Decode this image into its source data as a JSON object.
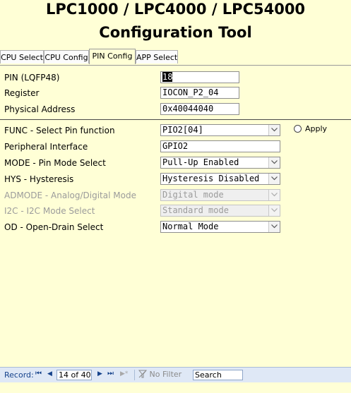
{
  "header": {
    "line1": "LPC1000 / LPC4000 / LPC54000",
    "line2": "Configuration Tool"
  },
  "tabs": [
    {
      "label": "CPU Select",
      "active": false
    },
    {
      "label": "CPU Config",
      "active": false
    },
    {
      "label": "PIN Config",
      "active": true
    },
    {
      "label": "APP Select",
      "active": false
    }
  ],
  "pin_section": {
    "pin_label": "PIN (LQFP48)",
    "pin_value": "18",
    "register_label": "Register",
    "register_value": "IOCON_P2_04",
    "address_label": "Physical Address",
    "address_value": "0x40044040"
  },
  "config_section": {
    "func_label": "FUNC - Select Pin function",
    "func_value": "PIO2[04]",
    "apply_label": "Apply",
    "periph_label": "Peripheral Interface",
    "periph_value": "GPIO2",
    "mode_label": "MODE - Pin Mode Select",
    "mode_value": "Pull-Up Enabled",
    "hys_label": "HYS - Hysteresis",
    "hys_value": "Hysteresis Disabled",
    "admode_label": "ADMODE - Analog/Digital Mode",
    "admode_value": "Digital mode",
    "i2c_label": "I2C - I2C Mode Select",
    "i2c_value": "Standard mode",
    "od_label": "OD - Open-Drain Select",
    "od_value": "Normal Mode"
  },
  "navigation": {
    "record_label": "Record:",
    "record_value": "14 of 40",
    "filter_label": "No Filter",
    "search_label": "Search",
    "first_glyph": "⏮",
    "prev_glyph": "◀",
    "next_glyph": "▶",
    "last_glyph": "⏭",
    "new_glyph": "▶*"
  },
  "colors": {
    "panel_bg": "#ffffd6",
    "nav_bg": "#dfe8f6"
  }
}
